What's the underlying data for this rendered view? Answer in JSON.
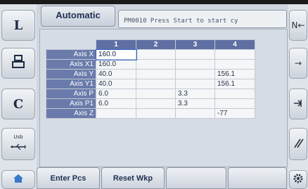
{
  "left_buttons": [
    {
      "label": "L",
      "icon": "letter-l"
    },
    {
      "label": "",
      "icon": "workpiece-icon"
    },
    {
      "label": "C",
      "icon": "letter-c"
    },
    {
      "label": "Usb",
      "icon": "usb-icon"
    },
    {
      "label": "",
      "icon": "home-icon"
    }
  ],
  "right_buttons": [
    {
      "label": "N←",
      "icon": "n-arrow-icon"
    },
    {
      "label": "→",
      "icon": "right-arrow-icon"
    },
    {
      "label": "",
      "icon": "arrow-branch-icon"
    },
    {
      "label": "",
      "icon": "stripes-icon"
    },
    {
      "label": "",
      "icon": "gear-icon"
    }
  ],
  "header": {
    "mode": "Automatic",
    "message": "PM0010 Press Start to start cy"
  },
  "grid": {
    "columns": [
      "1",
      "2",
      "3",
      "4"
    ],
    "rows": [
      {
        "label": "Axis X",
        "values": [
          "160.0",
          "",
          "",
          ""
        ]
      },
      {
        "label": "Axis X1",
        "values": [
          "160.0",
          "",
          "",
          ""
        ]
      },
      {
        "label": "Axis Y",
        "values": [
          "40.0",
          "",
          "",
          "156.1"
        ]
      },
      {
        "label": "Axis Y1",
        "values": [
          "40.0",
          "",
          "",
          "156.1"
        ]
      },
      {
        "label": "Axis P",
        "values": [
          "6.0",
          "",
          "3.3",
          ""
        ]
      },
      {
        "label": "Axis P1",
        "values": [
          "6.0",
          "",
          "3.3",
          ""
        ]
      },
      {
        "label": "Axis Z",
        "values": [
          "",
          "",
          "",
          "-77"
        ]
      }
    ]
  },
  "softkeys": [
    "Enter Pcs",
    "Reset Wkp",
    "",
    ""
  ],
  "colors": {
    "header_blue": "#5f6fa3",
    "row_label_blue": "#6a7bab",
    "panel_gray": "#d6dce4",
    "cell_white": "#f4f6f8"
  }
}
